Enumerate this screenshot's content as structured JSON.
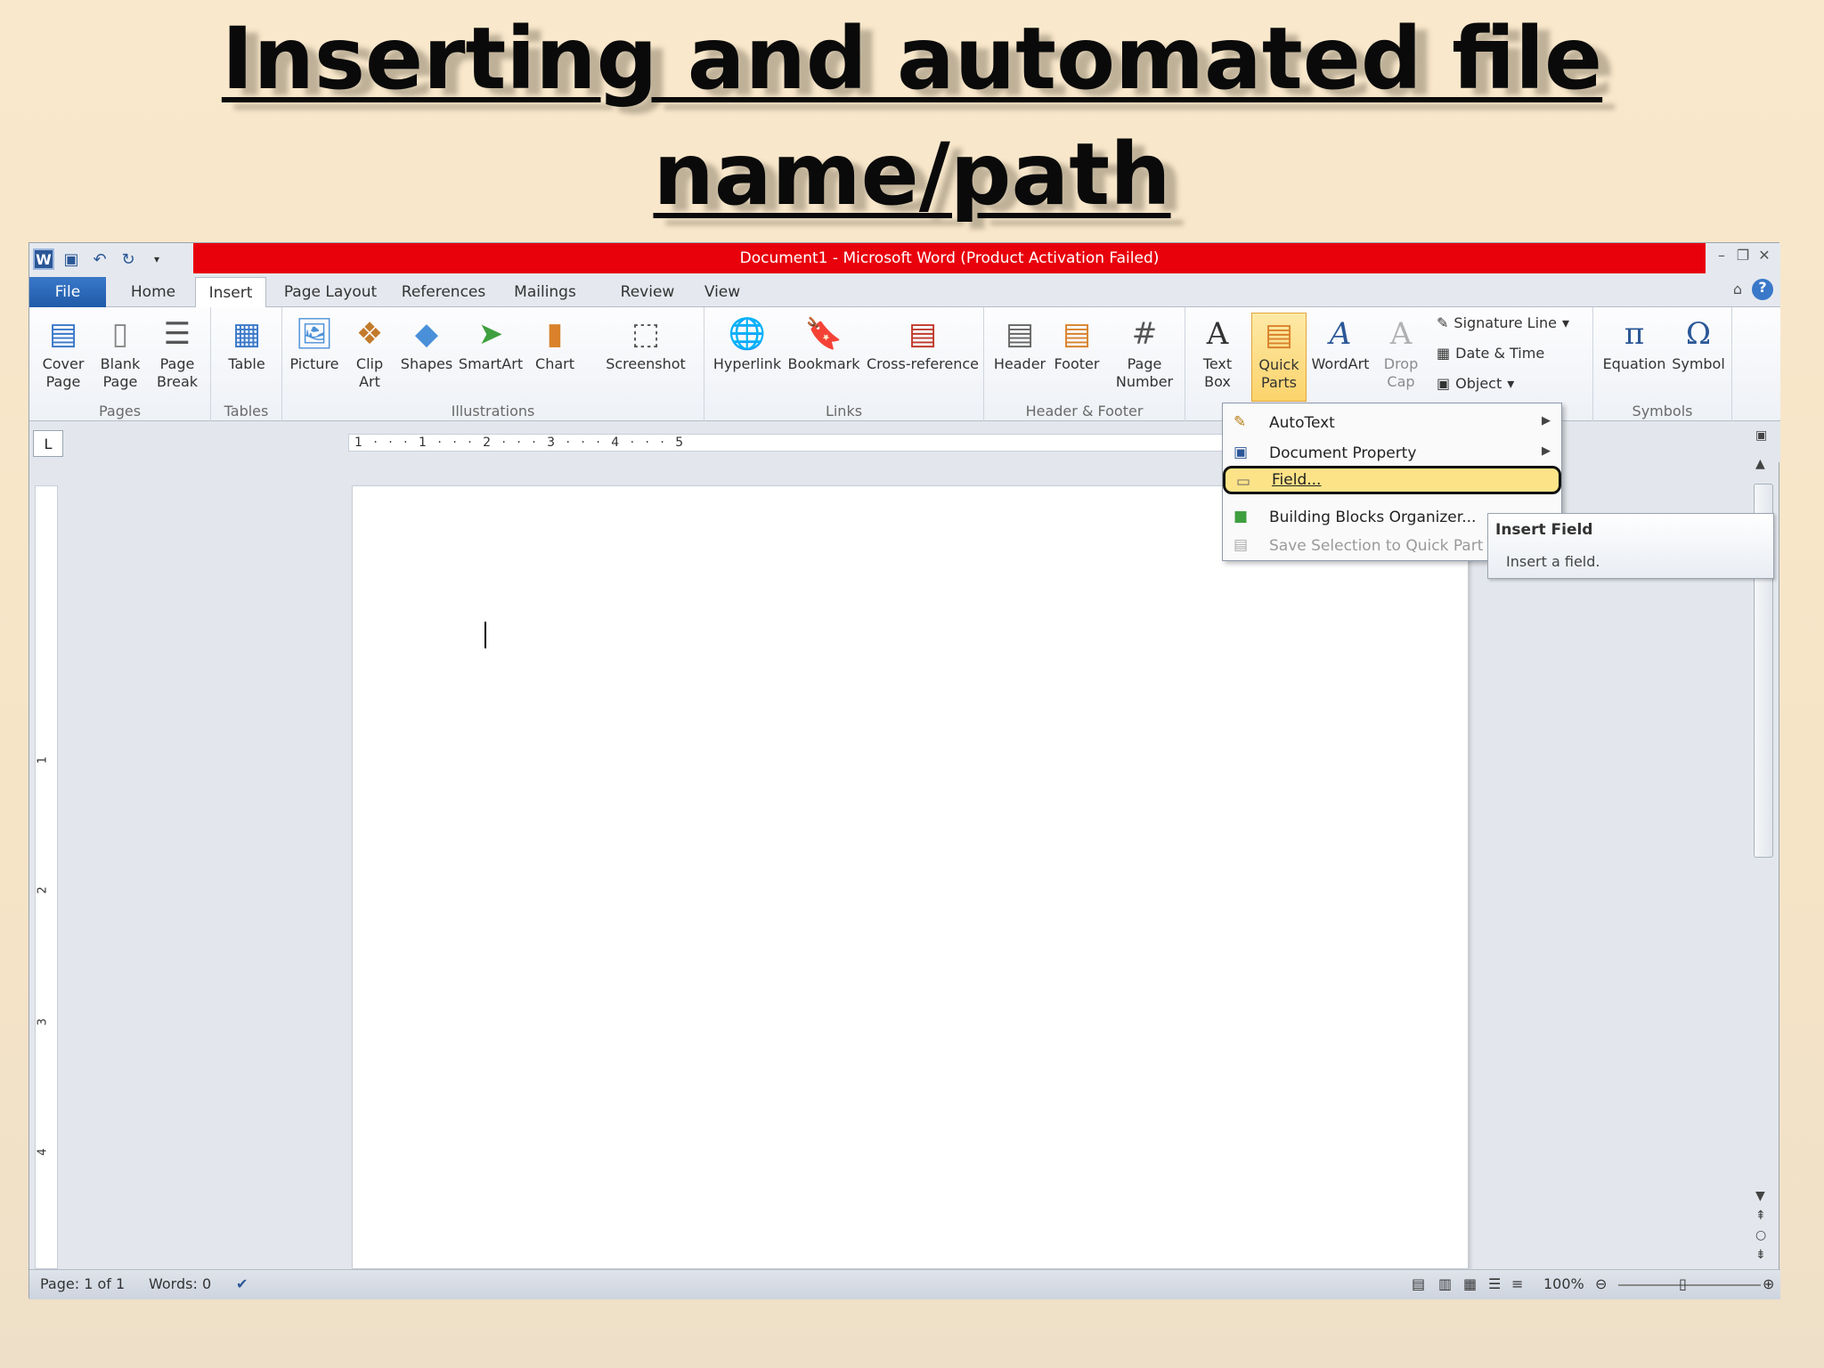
{
  "slide": {
    "title_line1": "Inserting and automated  file",
    "title_line2": "name/path"
  },
  "window": {
    "title": "Document1  -  Microsoft Word (Product Activation Failed)",
    "titlebar_color": "#e8000b"
  },
  "tabs": [
    {
      "label": "File"
    },
    {
      "label": "Home"
    },
    {
      "label": "Insert"
    },
    {
      "label": "Page Layout"
    },
    {
      "label": "References"
    },
    {
      "label": "Mailings"
    },
    {
      "label": "Review"
    },
    {
      "label": "View"
    }
  ],
  "ribbon": {
    "groups": {
      "pages": "Pages",
      "tables": "Tables",
      "illustrations": "Illustrations",
      "links": "Links",
      "header_footer": "Header & Footer",
      "symbols": "Symbols"
    },
    "buttons": {
      "cover_page": "Cover Page",
      "blank_page": "Blank Page",
      "page_break": "Page Break",
      "table": "Table",
      "picture": "Picture",
      "clip_art": "Clip Art",
      "shapes": "Shapes",
      "smartart": "SmartArt",
      "chart": "Chart",
      "screenshot": "Screenshot",
      "hyperlink": "Hyperlink",
      "bookmark": "Bookmark",
      "cross_reference": "Cross-reference",
      "header": "Header",
      "footer": "Footer",
      "page_number": "Page Number",
      "text_box": "Text Box",
      "quick_parts": "Quick Parts",
      "wordart": "WordArt",
      "drop_cap": "Drop Cap",
      "signature_line": "Signature Line",
      "date_time": "Date & Time",
      "object": "Object",
      "equation": "Equation",
      "symbol": "Symbol"
    }
  },
  "ruler": {
    "ticks": "1 · · · 1 · · · 2 · · · 3 · · · 4 · · · 5",
    "vertical_numbers": [
      "1",
      "2",
      "3",
      "4"
    ]
  },
  "quick_parts_menu": {
    "items": [
      {
        "label": "AutoText",
        "submenu": true
      },
      {
        "label": "Document Property",
        "submenu": true
      },
      {
        "label": "Field...",
        "highlighted": true
      },
      {
        "label": "Building Blocks Organizer..."
      },
      {
        "label": "Save Selection to Quick Part Ga",
        "disabled": true
      }
    ]
  },
  "tooltip": {
    "title": "Insert Field",
    "description": "Insert a field."
  },
  "status_bar": {
    "page": "Page: 1 of 1",
    "words": "Words: 0",
    "zoom": "100%"
  },
  "colors": {
    "slide_background": "#f6e4c6",
    "highlight": "#fde387",
    "file_tab": "#2b6cbf"
  }
}
